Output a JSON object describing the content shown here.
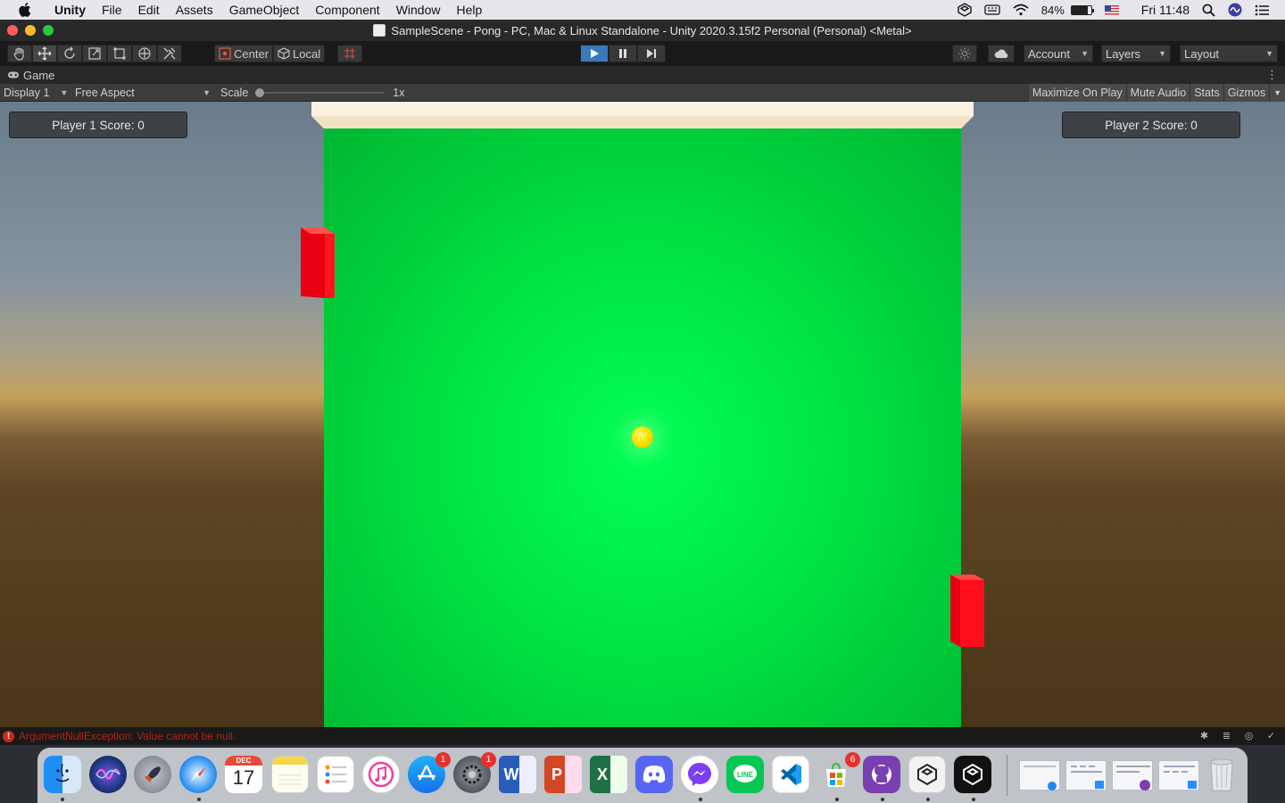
{
  "menubar": {
    "app_name": "Unity",
    "items": [
      "File",
      "Edit",
      "Assets",
      "GameObject",
      "Component",
      "Window",
      "Help"
    ],
    "battery": "84%",
    "battery_level": 0.84,
    "clock": "Fri 11:48"
  },
  "window": {
    "title": "SampleScene - Pong - PC, Mac & Linux Standalone - Unity 2020.3.15f2 Personal (Personal) <Metal>"
  },
  "toolbar": {
    "pivot_label": "Center",
    "space_label": "Local",
    "play_state": "playing",
    "account_label": "Account",
    "layers_label": "Layers",
    "layout_label": "Layout"
  },
  "game_tab": {
    "label": "Game"
  },
  "game_bar": {
    "display": "Display 1",
    "aspect": "Free Aspect",
    "scale_label": "Scale",
    "scale_value": "1x",
    "maximize": "Maximize On Play",
    "mute": "Mute Audio",
    "stats": "Stats",
    "gizmos": "Gizmos"
  },
  "game": {
    "player1_score": "Player 1 Score: 0",
    "player2_score": "Player 2 Score: 0",
    "colors": {
      "field": "#00e043",
      "paddle": "#ff0a17",
      "ball": "#ffe600",
      "wall": "#fbf1e0"
    }
  },
  "status": {
    "error": "ArgumentNullException: Value cannot be null."
  },
  "dock": {
    "calendar_month": "DEC",
    "calendar_day": "17",
    "appstore_badge": "1",
    "settings_badge": "1",
    "msstore_badge": "6",
    "icons": [
      "finder-icon",
      "siri-icon",
      "launchpad-icon",
      "safari-icon",
      "calendar-icon",
      "notes-icon",
      "reminders-icon",
      "music-icon",
      "app-store-icon",
      "system-preferences-icon",
      "word-icon",
      "powerpoint-icon",
      "excel-icon",
      "discord-icon",
      "messenger-icon",
      "line-icon",
      "vscode-icon",
      "microsoft-store-icon",
      "github-desktop-icon",
      "unity-hub-icon",
      "unity-icon",
      "trash-icon"
    ]
  }
}
